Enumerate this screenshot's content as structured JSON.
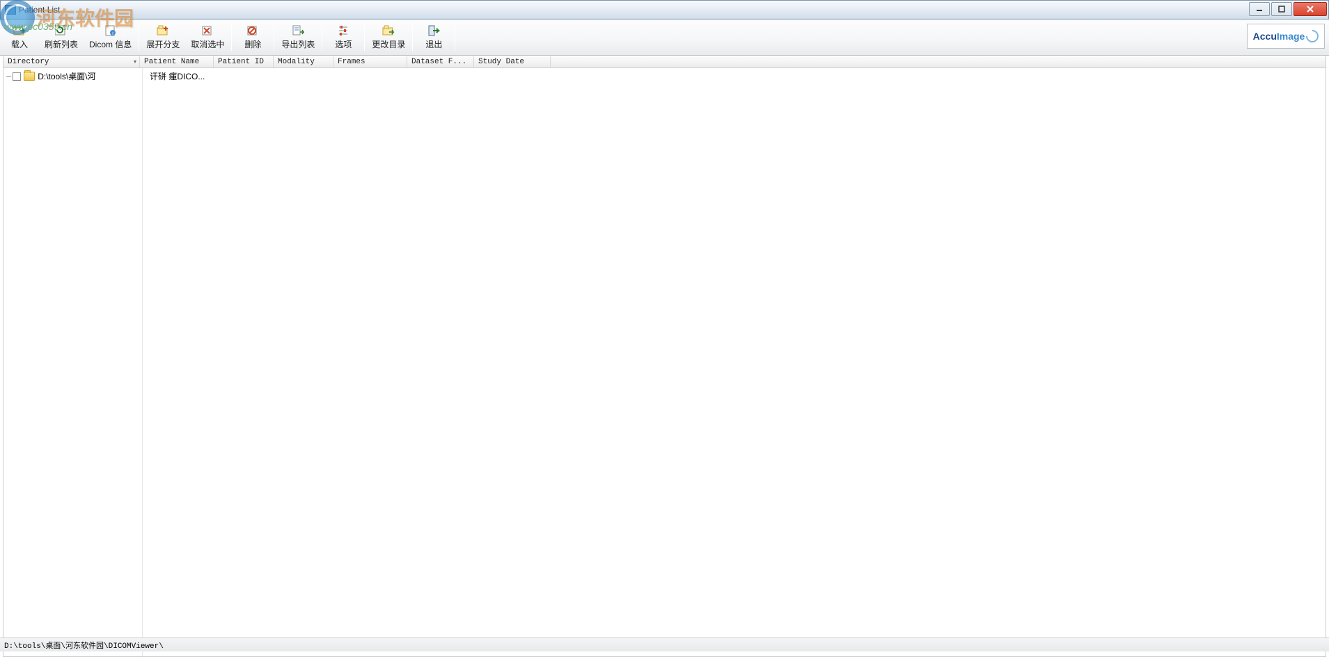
{
  "window": {
    "title": "Patient List"
  },
  "watermark": {
    "text": "河东软件园",
    "url": "www.pc0359.cn"
  },
  "toolbar": {
    "import_label": "载入",
    "refresh_label": "刷新列表",
    "dicom_info_label": "Dicom 信息",
    "expand_label": "展开分支",
    "deselect_label": "取消选中",
    "delete_label": "删除",
    "export_label": "导出列表",
    "options_label": "选项",
    "change_dir_label": "更改目录",
    "exit_label": "退出"
  },
  "brand": {
    "name_part1": "Accu",
    "name_part2": "Image"
  },
  "columns": {
    "directory": "Directory",
    "patient_name": "Patient Name",
    "patient_id": "Patient ID",
    "modality": "Modality",
    "frames": "Frames",
    "dataset_f": "Dataset F...",
    "study_date": "Study Date"
  },
  "tree": {
    "items": [
      {
        "path": "D:\\tools\\桌面\\河"
      }
    ]
  },
  "rows": [
    {
      "patient_name": "讦硑   瘇DICO..."
    }
  ],
  "statusbar": {
    "path": "D:\\tools\\桌面\\河东软件园\\DICOMViewer\\"
  }
}
